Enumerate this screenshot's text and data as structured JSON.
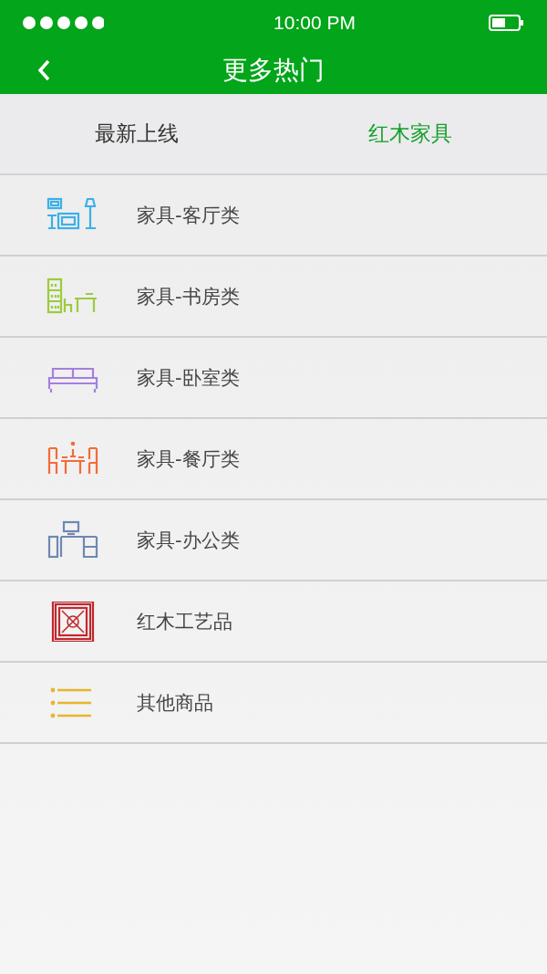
{
  "status_bar": {
    "time": "10:00 PM"
  },
  "nav": {
    "title": "更多热门"
  },
  "tabs": [
    {
      "label": "最新上线",
      "selected": false
    },
    {
      "label": "红木家具",
      "selected": true
    }
  ],
  "items": [
    {
      "label": "家具-客厅类",
      "kind": "living",
      "color": "#3bb0e8"
    },
    {
      "label": "家具-书房类",
      "kind": "study",
      "color": "#9ccc3c"
    },
    {
      "label": "家具-卧室类",
      "kind": "bedroom",
      "color": "#a57fe0"
    },
    {
      "label": "家具-餐厅类",
      "kind": "dining",
      "color": "#f26b3a"
    },
    {
      "label": "家具-办公类",
      "kind": "office",
      "color": "#6f88b0"
    },
    {
      "label": "红木工艺品",
      "kind": "craft",
      "color": "#c0282e"
    },
    {
      "label": "其他商品",
      "kind": "list",
      "color": "#e8b52a"
    }
  ]
}
